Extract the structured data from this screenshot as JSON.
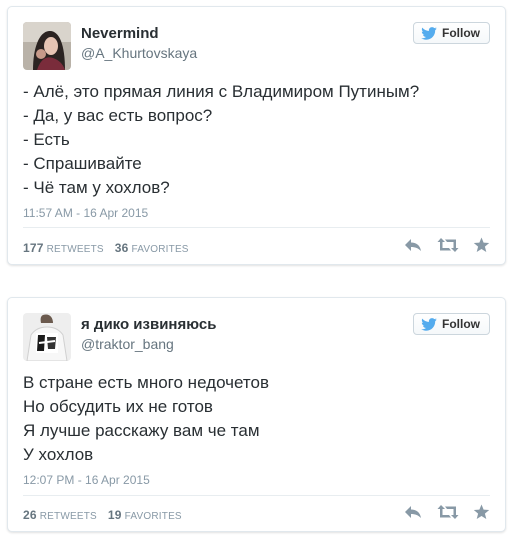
{
  "tweets": [
    {
      "name": "Nevermind",
      "handle": "@A_Khurtovskaya",
      "follow_label": "Follow",
      "lines": [
        "- Алё, это прямая линия с Владимиром Путиным?",
        "- Да, у вас есть вопрос?",
        "- Есть",
        "- Спрашивайте",
        "- Чё там у хохлов?"
      ],
      "timestamp": "11:57 AM - 16 Apr 2015",
      "retweets_count": "177",
      "retweets_label": "RETWEETS",
      "favorites_count": "36",
      "favorites_label": "FAVORITES"
    },
    {
      "name": "я дико извиняюсь",
      "handle": "@traktor_bang",
      "follow_label": "Follow",
      "lines": [
        "В стране есть много недочетов",
        "Но обсудить их не готов",
        "Я лучше расскажу вам че там",
        "У хохлов"
      ],
      "timestamp": "12:07 PM - 16 Apr 2015",
      "retweets_count": "26",
      "retweets_label": "RETWEETS",
      "favorites_count": "19",
      "favorites_label": "FAVORITES"
    }
  ],
  "colors": {
    "twitter_blue": "#55acee",
    "text": "#292f33",
    "muted": "#8899a6",
    "icon": "#8899a6"
  },
  "icons": [
    "twitter-bird-icon",
    "reply-icon",
    "retweet-icon",
    "favorite-star-icon"
  ]
}
